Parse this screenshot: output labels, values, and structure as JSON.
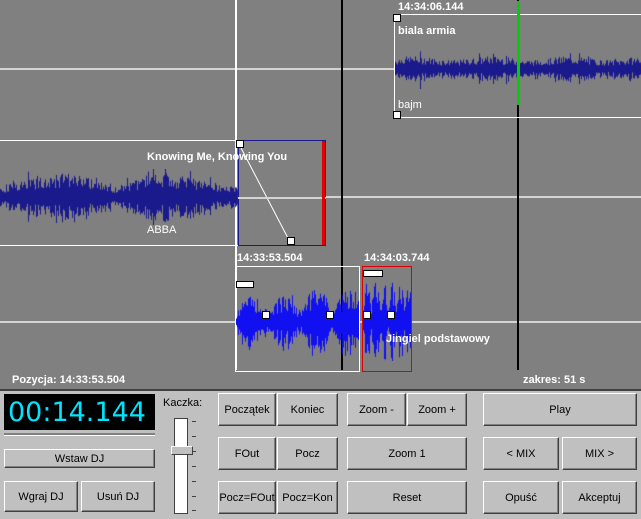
{
  "timeline": {
    "clips": [
      {
        "start_time": "14:34:06.144",
        "title": "biala armia",
        "artist": "bajm"
      },
      {
        "start_time": "",
        "title": "Knowing Me, Knowing You",
        "artist": "ABBA"
      },
      {
        "start_time": "14:33:53.504",
        "title": "",
        "artist": ""
      },
      {
        "start_time": "14:34:03.744",
        "title": "Jingiel podstawowy",
        "artist": ""
      }
    ],
    "position_label": "Pozycja: 14:33:53.504",
    "range_label": "zakres: 51 s",
    "colors": {
      "background": "#808080",
      "wave_dark": "#1a1a8c",
      "wave_bright": "#1010f0",
      "cue_green": "#00d000",
      "cue_red": "#e00000"
    }
  },
  "controls": {
    "clock": "00:14.144",
    "kaczka_label": "Kaczka:",
    "duck_level": 0.7,
    "buttons": {
      "wstaw_dj": "Wstaw DJ",
      "wgraj_dj": "Wgraj DJ",
      "usun_dj": "Usuń DJ",
      "poczatek": "Początek",
      "koniec": "Koniec",
      "fout": "FOut",
      "pocz": "Pocz",
      "pocz_fout": "Pocz=FOut",
      "pocz_kon": "Pocz=Kon",
      "zoom_minus": "Zoom -",
      "zoom_plus": "Zoom +",
      "zoom_1": "Zoom 1",
      "reset": "Reset",
      "play": "Play",
      "mix_prev": "< MIX",
      "mix_next": "MIX >",
      "opusc": "Opuść",
      "akceptuj": "Akceptuj"
    }
  }
}
